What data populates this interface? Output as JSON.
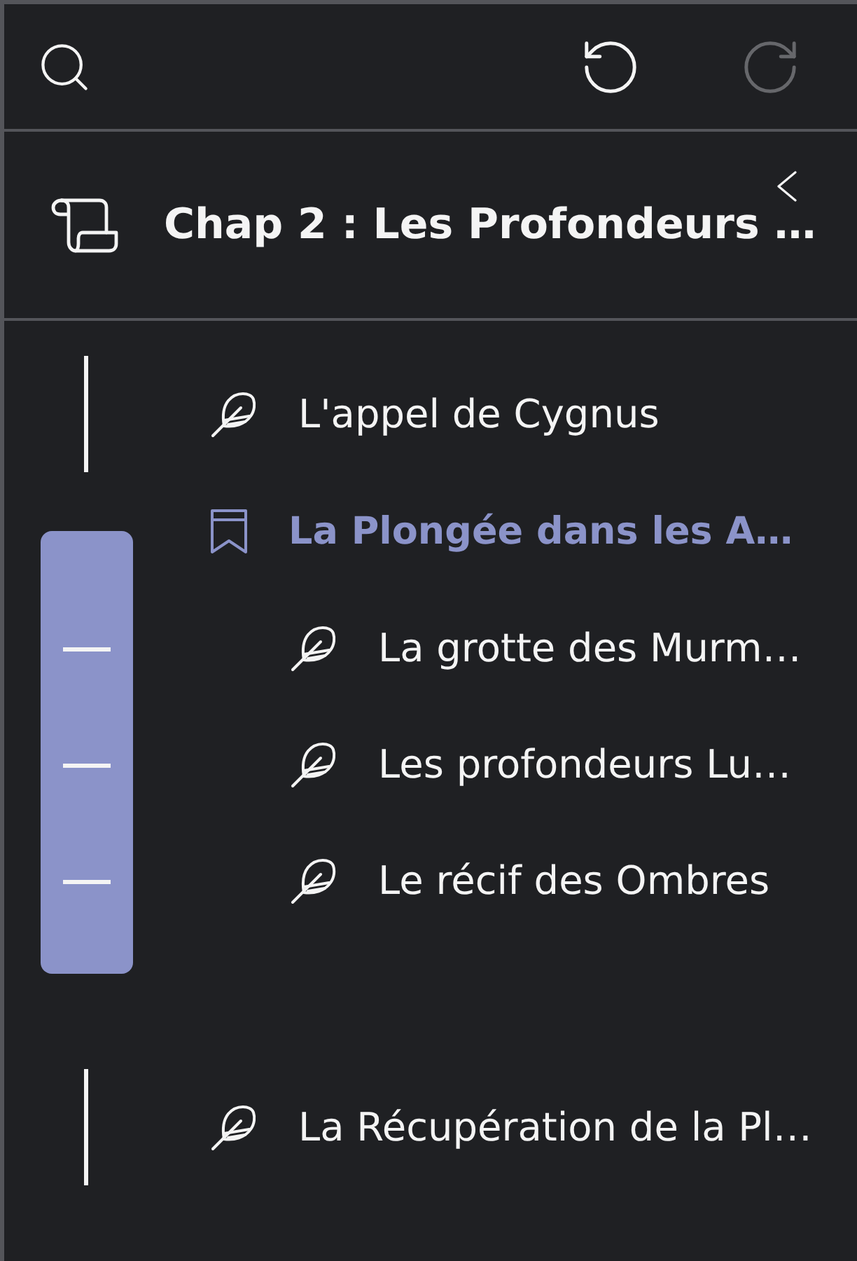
{
  "toolbar": {
    "buttons": [
      {
        "kind": "search",
        "disabled": false
      },
      {
        "kind": "undo",
        "disabled": false
      },
      {
        "kind": "redo",
        "disabled": true
      }
    ]
  },
  "chapter": {
    "title": "Chap 2 : Les Profondeurs …"
  },
  "items": [
    {
      "title": "L'appel de Cygnus",
      "kind": "feather",
      "selected": false
    },
    {
      "title": "La Plongée dans les A…",
      "kind": "bookmark",
      "selected": true,
      "children": [
        {
          "title": "La grotte des Murm…",
          "kind": "feather",
          "selected": false
        },
        {
          "title": "Les profondeurs Lu…",
          "kind": "feather",
          "selected": false
        },
        {
          "title": "Le récif des Ombres",
          "kind": "feather",
          "selected": false
        }
      ]
    },
    {
      "title": "La Récupération de la Pl…",
      "kind": "feather",
      "selected": false
    }
  ]
}
